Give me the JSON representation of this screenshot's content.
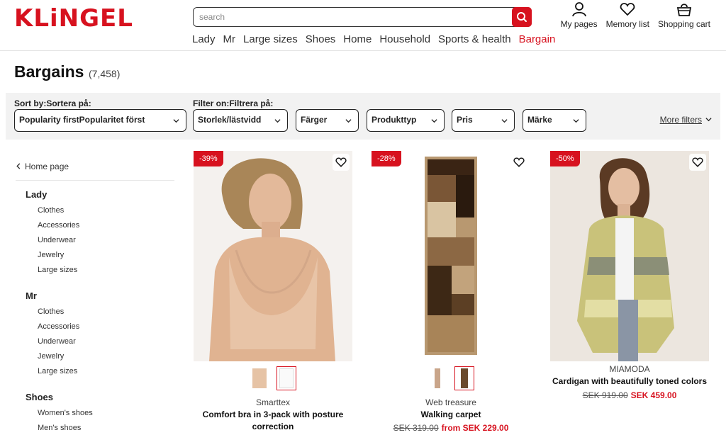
{
  "header": {
    "logo": "KLiNGEL",
    "search_placeholder": "search",
    "nav": [
      "Lady",
      "Mr",
      "Large sizes",
      "Shoes",
      "Home",
      "Household",
      "Sports & health",
      "Bargain"
    ],
    "active_nav": "Bargain",
    "tools": [
      {
        "label": "My pages",
        "icon": "person-icon"
      },
      {
        "label": "Memory list",
        "icon": "heart-icon"
      },
      {
        "label": "Shopping cart",
        "icon": "basket-icon"
      }
    ]
  },
  "page": {
    "title": "Bargains",
    "count": "(7,458)"
  },
  "filters": {
    "sort_label": "Sort by:Sortera på:",
    "filter_label": "Filter on:Filtrera på:",
    "sort_value": "Popularity firstPopularitet först",
    "options": [
      "Storlek/lästvidd",
      "Färger",
      "Produkttyp",
      "Pris",
      "Märke"
    ],
    "more": "More filters"
  },
  "sidebar": {
    "home": "Home page",
    "sections": [
      {
        "title": "Lady",
        "items": [
          "Clothes",
          "Accessories",
          "Underwear",
          "Jewelry",
          "Large sizes"
        ]
      },
      {
        "title": "Mr",
        "items": [
          "Clothes",
          "Accessories",
          "Underwear",
          "Jewelry",
          "Large sizes"
        ]
      },
      {
        "title": "Shoes",
        "items": [
          "Women's shoes",
          "Men's shoes"
        ]
      }
    ]
  },
  "products": [
    {
      "badge": "-39%",
      "brand": "Smarttex",
      "name": "Comfort bra in 3-pack with posture correction",
      "old_price": "",
      "new_price": ""
    },
    {
      "badge": "-28%",
      "brand": "Web treasure",
      "name": "Walking carpet",
      "old_price": "SEK 319.00",
      "new_price": "from SEK 229.00"
    },
    {
      "badge": "-50%",
      "brand": "MIAMODA",
      "name": "Cardigan with beautifully toned colors",
      "old_price": "SEK 919.00",
      "new_price": "SEK 459.00"
    }
  ],
  "colors": {
    "brand_red": "#d7121f"
  }
}
